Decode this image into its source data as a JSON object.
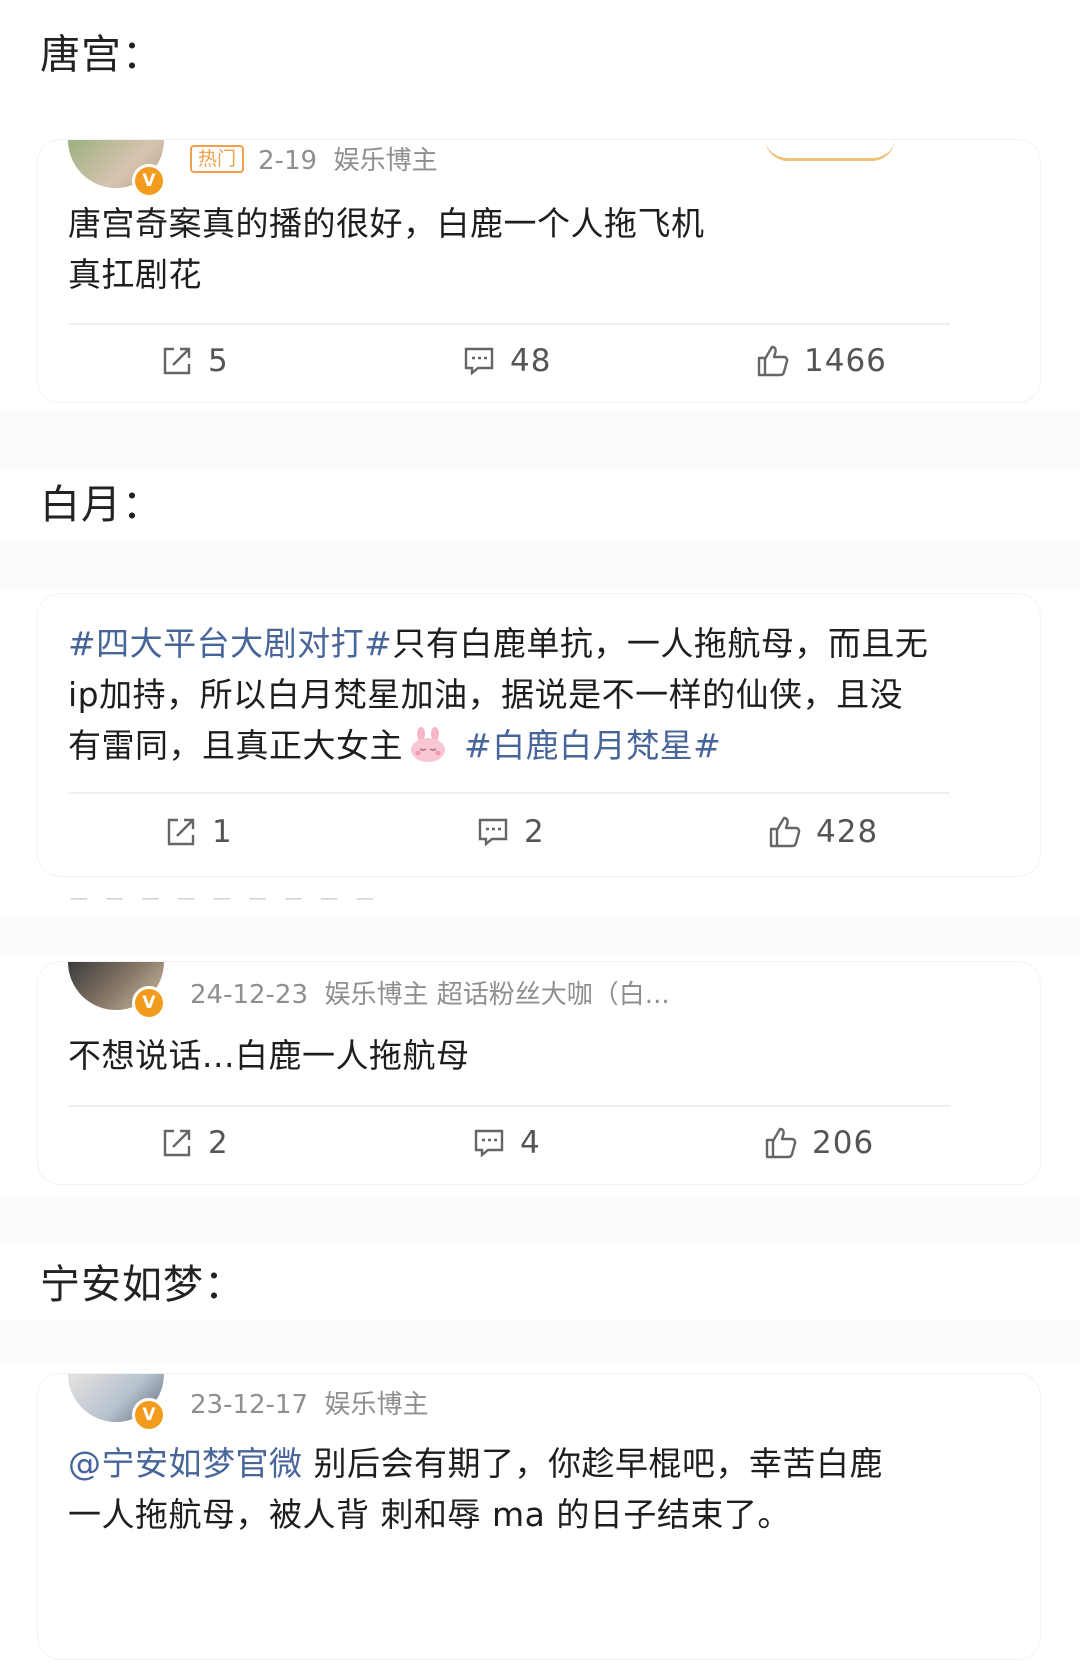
{
  "sections": [
    {
      "label": "唐宫：",
      "post": {
        "hot_tag": "热门",
        "date": "2-19",
        "role": "娱乐博主",
        "text_line1": "唐宫奇案真的播的很好，白鹿一个人拖飞机",
        "text_line2": "真扛剧花",
        "repost_count": "5",
        "comment_count": "48",
        "like_count": "1466"
      }
    },
    {
      "label": "白月：",
      "post": {
        "line1_hashtag": "#四大平台大剧对打#",
        "line1_text": "只有白鹿单抗，一人拖航母，而且无",
        "line2_text": "ip加持，所以白月梵星加油，据说是不一样的仙侠，且没",
        "line3_text": "有雷同，且真正大女主",
        "line3_hashtag": "#白鹿白月梵星#",
        "repost_count": "1",
        "comment_count": "2",
        "like_count": "428"
      },
      "post2": {
        "date": "24-12-23",
        "meta": "娱乐博主  超话粉丝大咖（白...",
        "text": "不想说话...白鹿一人拖航母",
        "repost_count": "2",
        "comment_count": "4",
        "like_count": "206"
      }
    },
    {
      "label": "宁安如梦：",
      "post": {
        "date": "23-12-17",
        "role": "娱乐博主",
        "mention": "@宁安如梦官微",
        "line1_text": " 别后会有期了，你趁早棍吧，幸苦白鹿",
        "line2_text": "一人拖航母，被人背 刺和辱 ma 的日子结束了。"
      }
    }
  ],
  "icons": {
    "repost": "repost-icon",
    "comment": "comment-icon",
    "like": "thumbs-up-icon",
    "verified": "verified-badge-icon",
    "emoji": "bunny-emoji-icon"
  },
  "colors": {
    "hashtag": "#48659a",
    "hot_tag": "#f0a04b",
    "verified_badge": "#f29b1c"
  }
}
